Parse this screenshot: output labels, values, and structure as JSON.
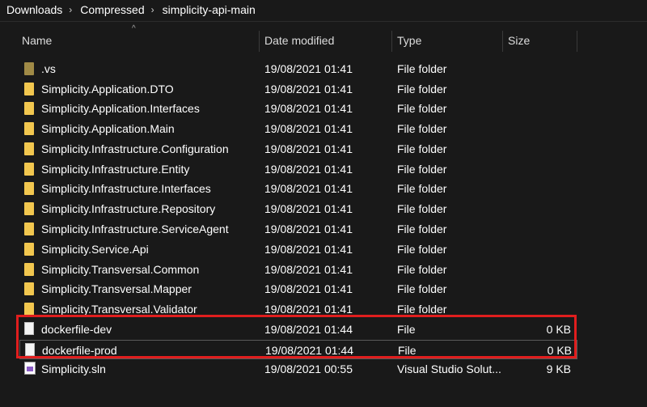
{
  "breadcrumb": {
    "items": [
      "Downloads",
      "Compressed",
      "simplicity-api-main"
    ],
    "separator": "›"
  },
  "columns": {
    "name": "Name",
    "date_modified": "Date modified",
    "type": "Type",
    "size": "Size"
  },
  "sort_indicator": "^",
  "files": [
    {
      "name": ".vs",
      "date": "19/08/2021 01:41",
      "type": "File folder",
      "size": "",
      "icon": "folder-icon-dim"
    },
    {
      "name": "Simplicity.Application.DTO",
      "date": "19/08/2021 01:41",
      "type": "File folder",
      "size": "",
      "icon": "folder-icon"
    },
    {
      "name": "Simplicity.Application.Interfaces",
      "date": "19/08/2021 01:41",
      "type": "File folder",
      "size": "",
      "icon": "folder-icon"
    },
    {
      "name": "Simplicity.Application.Main",
      "date": "19/08/2021 01:41",
      "type": "File folder",
      "size": "",
      "icon": "folder-icon"
    },
    {
      "name": "Simplicity.Infrastructure.Configuration",
      "date": "19/08/2021 01:41",
      "type": "File folder",
      "size": "",
      "icon": "folder-icon"
    },
    {
      "name": "Simplicity.Infrastructure.Entity",
      "date": "19/08/2021 01:41",
      "type": "File folder",
      "size": "",
      "icon": "folder-icon"
    },
    {
      "name": "Simplicity.Infrastructure.Interfaces",
      "date": "19/08/2021 01:41",
      "type": "File folder",
      "size": "",
      "icon": "folder-icon"
    },
    {
      "name": "Simplicity.Infrastructure.Repository",
      "date": "19/08/2021 01:41",
      "type": "File folder",
      "size": "",
      "icon": "folder-icon"
    },
    {
      "name": "Simplicity.Infrastructure.ServiceAgent",
      "date": "19/08/2021 01:41",
      "type": "File folder",
      "size": "",
      "icon": "folder-icon"
    },
    {
      "name": "Simplicity.Service.Api",
      "date": "19/08/2021 01:41",
      "type": "File folder",
      "size": "",
      "icon": "folder-icon"
    },
    {
      "name": "Simplicity.Transversal.Common",
      "date": "19/08/2021 01:41",
      "type": "File folder",
      "size": "",
      "icon": "folder-icon"
    },
    {
      "name": "Simplicity.Transversal.Mapper",
      "date": "19/08/2021 01:41",
      "type": "File folder",
      "size": "",
      "icon": "folder-icon"
    },
    {
      "name": "Simplicity.Transversal.Validator",
      "date": "19/08/2021 01:41",
      "type": "File folder",
      "size": "",
      "icon": "folder-icon"
    },
    {
      "name": "dockerfile-dev",
      "date": "19/08/2021 01:44",
      "type": "File",
      "size": "0 KB",
      "icon": "file-icon"
    },
    {
      "name": "dockerfile-prod",
      "date": "19/08/2021 01:44",
      "type": "File",
      "size": "0 KB",
      "icon": "file-icon"
    },
    {
      "name": "Simplicity.sln",
      "date": "19/08/2021 00:55",
      "type": "Visual Studio Solut...",
      "size": "9 KB",
      "icon": "visual-studio-solution-icon"
    }
  ],
  "colors": {
    "background": "#191919",
    "folder": "#f2c74f",
    "highlight_border": "#e01e1e"
  }
}
